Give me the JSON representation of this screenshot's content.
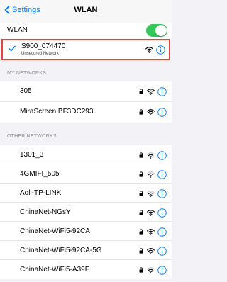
{
  "nav": {
    "back_label": "Settings",
    "title": "WLAN"
  },
  "wlan_toggle": {
    "label": "WLAN",
    "on": true
  },
  "connected": {
    "name": "S900_074470",
    "subtitle": "Unsecured Network"
  },
  "my_networks": {
    "header": "MY NETWORKS",
    "items": [
      {
        "name": "305",
        "locked": true
      },
      {
        "name": "MiraScreen BF3DC293",
        "locked": true
      }
    ]
  },
  "other_networks": {
    "header": "OTHER NETWORKS",
    "items": [
      {
        "name": "1301_3",
        "locked": true
      },
      {
        "name": "4GMIFI_505",
        "locked": true
      },
      {
        "name": "Aoli-TP-LINK",
        "locked": true
      },
      {
        "name": "ChinaNet-NGsY",
        "locked": true
      },
      {
        "name": "ChinaNet-WiFi5-92CA",
        "locked": true
      },
      {
        "name": "ChinaNet-WiFi5-92CA-5G",
        "locked": true
      },
      {
        "name": "ChinaNet-WiFi5-A39F",
        "locked": true
      }
    ]
  },
  "colors": {
    "accent": "#007aff",
    "toggle_on": "#34c759",
    "highlight": "#e0463a"
  }
}
